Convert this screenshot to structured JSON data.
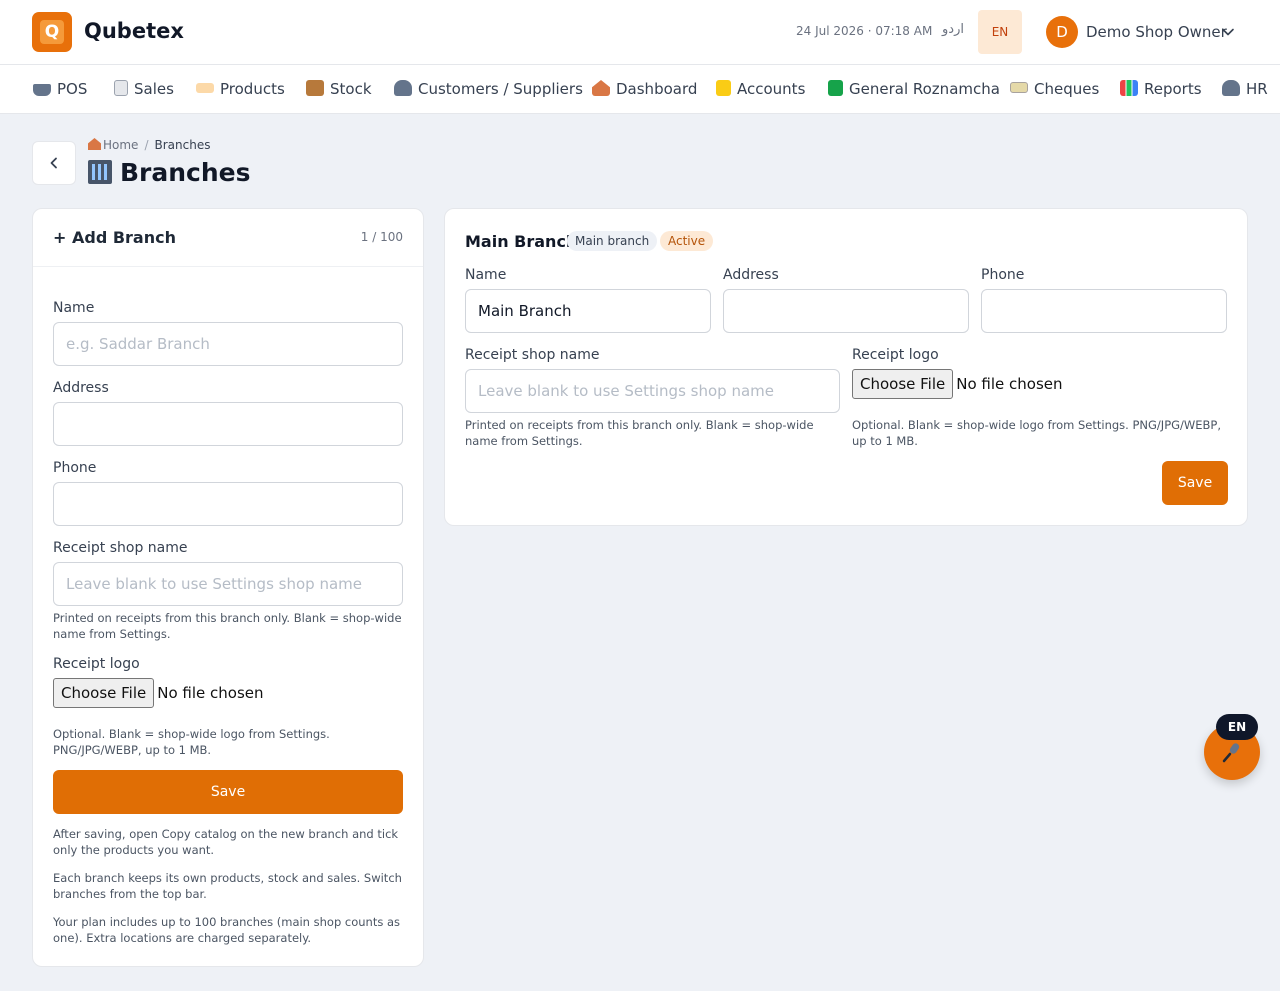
{
  "app": {
    "name": "Qubetex",
    "logo_letter": "Q",
    "accent": "#e8700a"
  },
  "topbar": {
    "datetime": "24 Jul 2026 · 07:18 AM",
    "lang_urdu": "اردو",
    "lang_en": "EN",
    "user_initial": "D",
    "user_name": "Demo Shop Owner"
  },
  "nav": {
    "items": [
      {
        "label": "POS",
        "icon": "cart-icon"
      },
      {
        "label": "Sales",
        "icon": "receipt-icon"
      },
      {
        "label": "Products",
        "icon": "tag-icon"
      },
      {
        "label": "Stock",
        "icon": "box-icon"
      },
      {
        "label": "Customers / Suppliers",
        "icon": "people-icon"
      },
      {
        "label": "Dashboard",
        "icon": "house-icon"
      },
      {
        "label": "Accounts",
        "icon": "ledger-icon"
      },
      {
        "label": "General Roznamcha",
        "icon": "green-book-icon"
      },
      {
        "label": "Cheques",
        "icon": "cheque-icon"
      },
      {
        "label": "Reports",
        "icon": "bar-chart-icon"
      },
      {
        "label": "HR",
        "icon": "people-icon"
      }
    ]
  },
  "breadcrumb": {
    "home": "Home",
    "current": "Branches"
  },
  "page": {
    "title": "Branches"
  },
  "add_form": {
    "title": "+ Add Branch",
    "count": "1 / 100",
    "name_label": "Name",
    "name_placeholder": "e.g. Saddar Branch",
    "address_label": "Address",
    "phone_label": "Phone",
    "receipt_shop_label": "Receipt shop name",
    "receipt_shop_placeholder": "Leave blank to use Settings shop name",
    "receipt_shop_help": "Printed on receipts from this branch only. Blank = shop-wide name from Settings.",
    "logo_label": "Receipt logo",
    "file_button": "Choose File",
    "file_status": "No file chosen",
    "logo_help": "Optional. Blank = shop-wide logo from Settings. PNG/JPG/WEBP, up to 1 MB.",
    "save_label": "Save",
    "note_1": "After saving, open Copy catalog on the new branch and tick only the products you want.",
    "note_2": "Each branch keeps its own products, stock and sales. Switch branches from the top bar.",
    "note_3": "Your plan includes up to 100 branches (main shop counts as one). Extra locations are charged separately."
  },
  "branch_card": {
    "title": "Main Branch",
    "badge_main": "Main branch",
    "badge_status": "Active",
    "name_label": "Name",
    "name_value": "Main Branch",
    "address_label": "Address",
    "address_value": "",
    "phone_label": "Phone",
    "phone_value": "",
    "receipt_shop_label": "Receipt shop name",
    "receipt_shop_placeholder": "Leave blank to use Settings shop name",
    "receipt_shop_help": "Printed on receipts from this branch only. Blank = shop-wide name from Settings.",
    "logo_label": "Receipt logo",
    "file_button": "Choose File",
    "file_status": "No file chosen",
    "logo_help": "Optional. Blank = shop-wide logo from Settings. PNG/JPG/WEBP, up to 1 MB.",
    "save_label": "Save"
  },
  "voice": {
    "lang": "EN",
    "icon": "microphone-icon"
  }
}
